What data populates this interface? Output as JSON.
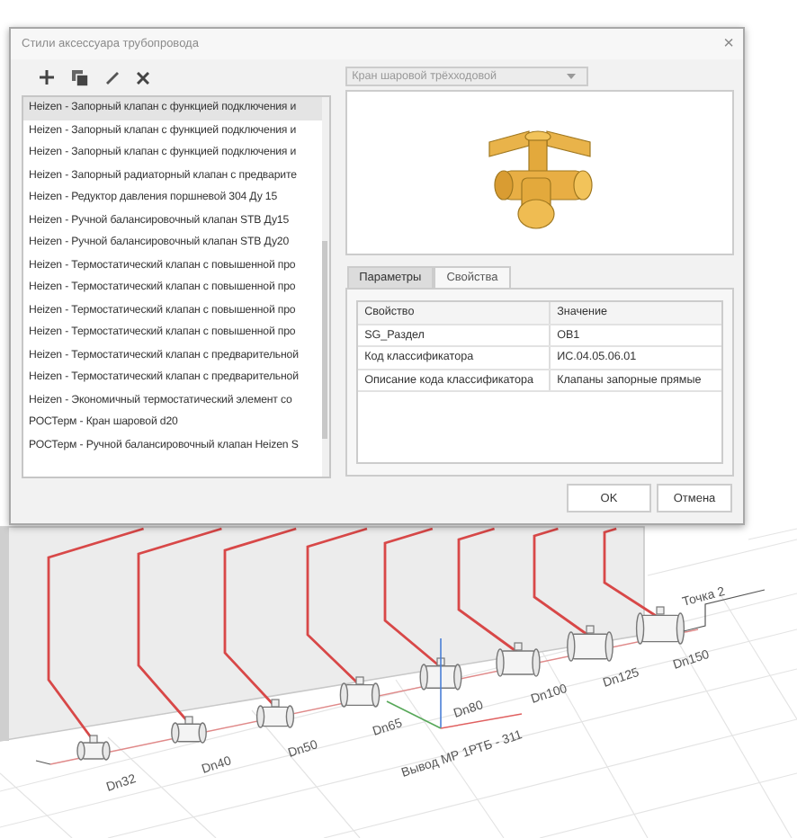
{
  "dialog": {
    "title": "Стили аксессуара трубопровода",
    "close": "×"
  },
  "styles_list": [
    {
      "label": "Heizen - Запорный клапан с функцией подключения и",
      "selected": true
    },
    {
      "label": "Heizen - Запорный клапан с функцией подключения и",
      "selected": false
    },
    {
      "label": "Heizen - Запорный клапан с функцией подключения и",
      "selected": false
    },
    {
      "label": "Heizen - Запорный радиаторный клапан с предварите",
      "selected": false
    },
    {
      "label": "Heizen - Редуктор давления поршневой 304 Ду 15",
      "selected": false
    },
    {
      "label": "Heizen - Ручной балансировочный клапан STB Ду15",
      "selected": false
    },
    {
      "label": "Heizen - Ручной балансировочный клапан STB Ду20",
      "selected": false
    },
    {
      "label": "Heizen - Термостатический клапан с повышенной про",
      "selected": false
    },
    {
      "label": "Heizen - Термостатический клапан с повышенной про",
      "selected": false
    },
    {
      "label": "Heizen - Термостатический клапан с повышенной про",
      "selected": false
    },
    {
      "label": "Heizen - Термостатический клапан с повышенной про",
      "selected": false
    },
    {
      "label": "Heizen - Термостатический клапан с предварительной",
      "selected": false
    },
    {
      "label": "Heizen - Термостатический клапан с предварительной",
      "selected": false
    },
    {
      "label": "Heizen - Экономичный термостатический элемент со",
      "selected": false
    },
    {
      "label": "РОСТерм - Кран шаровой d20",
      "selected": false
    },
    {
      "label": "РОСТерм - Ручной балансировочный клапан Heizen S",
      "selected": false
    }
  ],
  "type_dropdown": {
    "value": "Кран шаровой трёхходовой",
    "disabled": true
  },
  "tabs": [
    {
      "label": "Параметры",
      "selected": false
    },
    {
      "label": "Свойства",
      "selected": true
    }
  ],
  "properties_table": {
    "columns": [
      "Свойство",
      "Значение"
    ],
    "rows": [
      [
        "SG_Раздел",
        "ОВ1"
      ],
      [
        "Код классификатора",
        "ИС.04.05.06.01"
      ],
      [
        "Описание кода классификатора",
        "Клапаны запорные прямые"
      ]
    ]
  },
  "buttons": [
    "OK",
    "Отмена"
  ],
  "scene": {
    "valve_labels": [
      "Dn32",
      "Dn40",
      "Dn50",
      "Dn65",
      "Dn80",
      "Dn100",
      "Dn125",
      "Dn150"
    ],
    "point_label": "Точка 2",
    "riser_label": "Вывод МР 1РТБ - 311"
  }
}
